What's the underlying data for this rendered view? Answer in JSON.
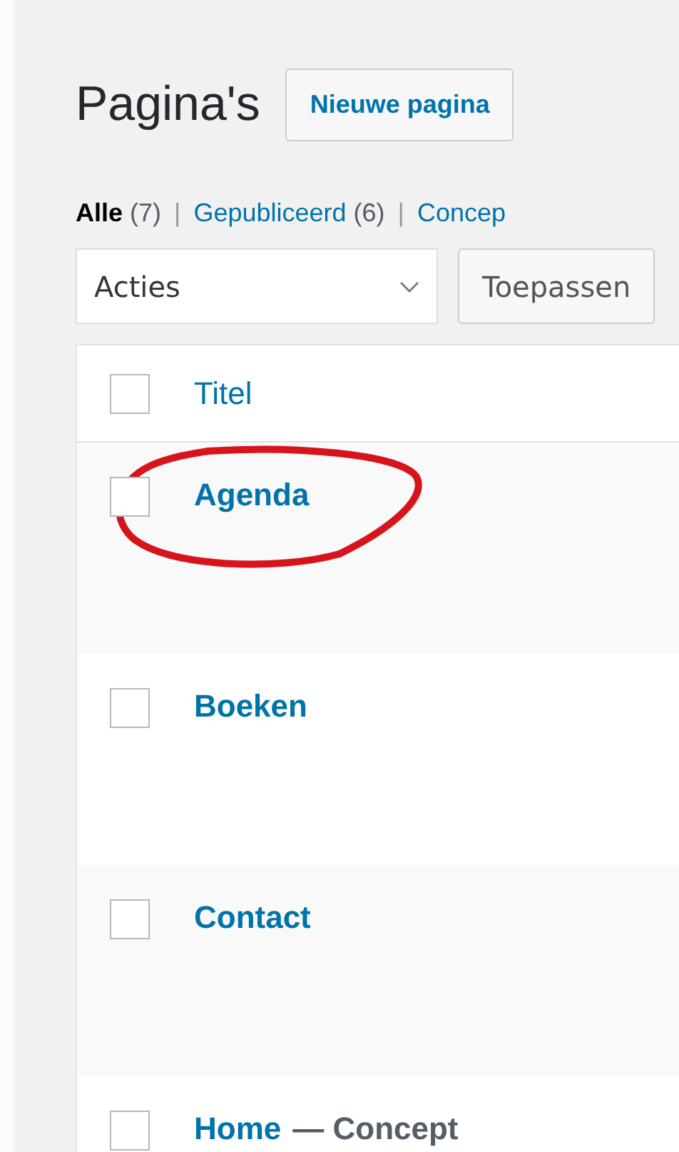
{
  "heading": {
    "title": "Pagina's",
    "button": "Nieuwe pagina"
  },
  "filters": [
    {
      "label": "Alle",
      "count": "(7)",
      "selected": true
    },
    {
      "separator": "|",
      "label": "Gepubliceerd",
      "count": "(6)",
      "selected": false
    },
    {
      "separator": "|",
      "label": "Concep",
      "selected": false
    }
  ],
  "bulk_actions": {
    "value": "Acties",
    "button": "Toepassen"
  },
  "table": {
    "columns": [
      {
        "label": "Titel",
        "checked": false
      }
    ],
    "rows": [
      {
        "title": "Agenda",
        "checked": false,
        "circled": true
      },
      {
        "title": "Boeken",
        "checked": false,
        "circled": false
      },
      {
        "title": "Contact",
        "checked": false,
        "circled": false
      },
      {
        "title": "Home",
        "state": "— Concept",
        "checked": false,
        "circled": false
      }
    ]
  }
}
